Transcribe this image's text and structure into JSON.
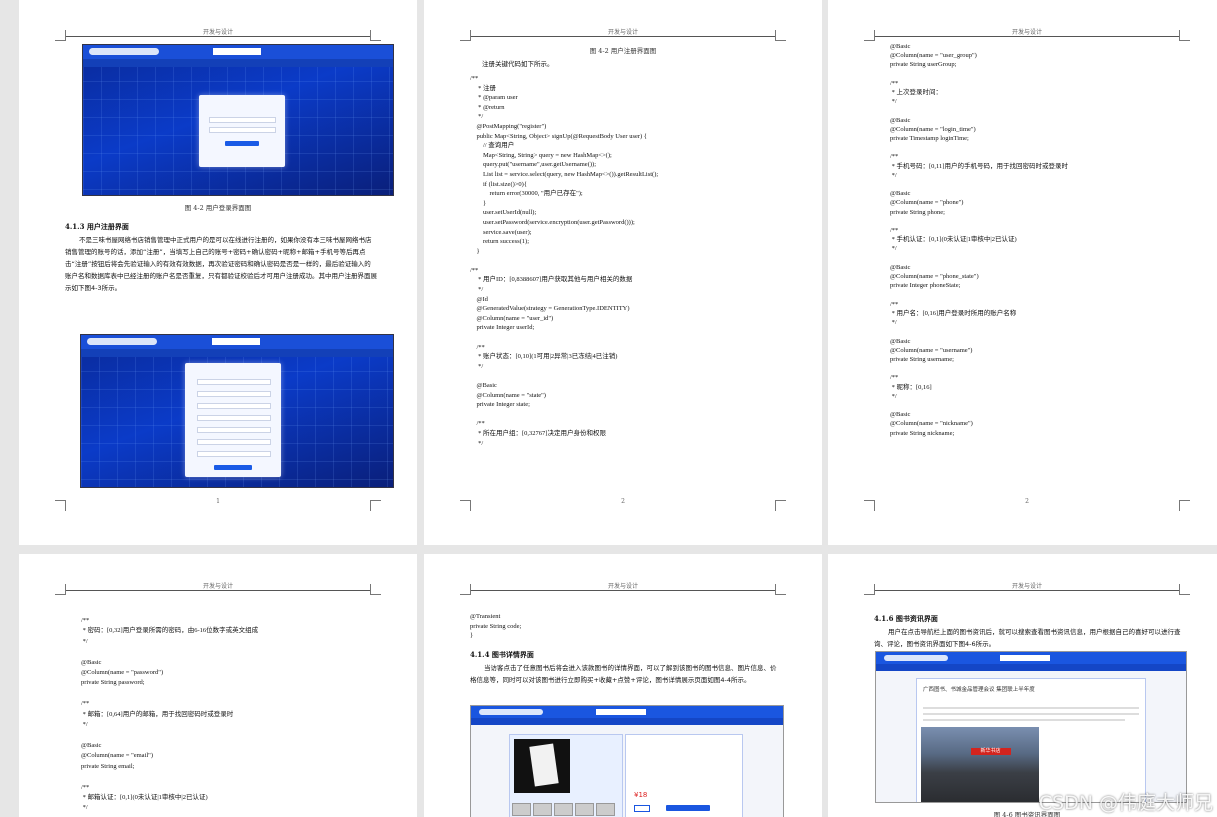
{
  "header": "开发与设计",
  "page1": {
    "caption_login": "图 4-2 用户登录界面图",
    "section_title": "4.1.3 用户注册界面",
    "paragraph": "不是三味书屋网络书店销售管理中正式用户的是可以在线进行注册的，如果你没有本三味书屋网络书店销售管理的账号的话，添加“注册”，当填写上自己的账号+密码+确认密码+昵称+邮箱+手机号等后再点击“注册”按钮后将会先验证输入的有效有效数据，再次验证密码和确认密码是否是一样的，最后验证输入的账户名和数据库表中已经注册的账户名是否重复，只有都验证校验后才可用户注册成功。其中用户注册界面展示如下图4-3所示。",
    "page_number": "1"
  },
  "page2": {
    "caption_top": "图 4-2 用户注册界面图",
    "intro": "注册关键代码如下所示。",
    "code": "/**\n     * 注册\n     * @param user\n     * @return\n     */\n    @PostMapping(\"register\")\n    public Map<String, Object> signUp(@RequestBody User user) {\n        // 查询用户\n        Map<String, String> query = new HashMap<>();\n        query.put(\"username\",user.getUsername());\n        List list = service.select(query, new HashMap<>()).getResultList();\n        if (list.size()>0){\n            return error(30000, \"用户已存在\");\n        }\n        user.setUserId(null);\n        user.setPassword(service.encryption(user.getPassword()));\n        service.save(user);\n        return success(1);\n    }\n\n/**\n     * 用户ID：[0,8388607]用户获取其他与用户相关的数据\n     */\n    @Id\n    @GeneratedValue(strategy = GenerationType.IDENTITY)\n    @Column(name = \"user_id\")\n    private Integer userId;\n\n    /**\n     * 账户状态：[0,10](1可用|2异常|3已冻结|4已注销)\n     */\n\n    @Basic\n    @Column(name = \"state\")\n    private Integer state;\n\n    /**\n     * 所在用户组：[0,32767]决定用户身份和权限\n     */",
    "page_number": "2"
  },
  "page3": {
    "code": "@Basic\n@Column(name = \"user_group\")\nprivate String userGroup;\n\n/**\n * 上次登录时间：\n */\n\n@Basic\n@Column(name = \"login_time\")\nprivate Timestamp loginTime;\n\n/**\n * 手机号码：[0,11]用户的手机号码，用于找回密码时或登录时\n */\n\n@Basic\n@Column(name = \"phone\")\nprivate String phone;\n\n/**\n * 手机认证：[0,1](0未认证|1审核中|2已认证)\n */\n\n@Basic\n@Column(name = \"phone_state\")\nprivate Integer phoneState;\n\n/**\n * 用户名：[0,16]用户登录时所用的账户名称\n */\n\n@Basic\n@Column(name = \"username\")\nprivate String username;\n\n/**\n * 昵称：[0,16]\n */\n\n@Basic\n@Column(name = \"nickname\")\nprivate String nickname;",
    "page_number": "2"
  },
  "page4": {
    "code": "/**\n * 密码：[0,32]用户登录所需的密码，由6-16位数字或英文组成\n */\n\n@Basic\n@Column(name = \"password\")\nprivate String password;\n\n/**\n * 邮箱：[0,64]用户的邮箱，用于找回密码时或登录时\n */\n\n@Basic\n@Column(name = \"email\")\nprivate String email;\n\n/**\n * 邮箱认证：[0,1](0未认证|1审核中|2已认证)\n */"
  },
  "page5": {
    "code": "@Transient\nprivate String code;\n}",
    "section_title": "4.1.4 图书详情界面",
    "paragraph": "当访客点击了任意图书后将会进入该款图书的详情界面，可以了解到该图书的图书信息、图片信息、价格信息等，同时可以对该图书进行立即购买+收藏+点赞+评论，图书详情展示页面如图4-4所示。",
    "price": "¥18"
  },
  "page6": {
    "section_title": "4.1.6 图书资讯界面",
    "paragraph": "用户在点击导航栏上面的图书资讯后，就可以搜索查看图书资讯信息，用户根据自己的喜好可以进行查询、评论，图书资讯界面如下图4-6所示。",
    "caption": "图 4-6 图书资讯界面图",
    "news_title": "广西图书、书城金品管理会议 集团联上半年度",
    "shop_sign": "新华书店",
    "watermark": "CSDN @伟庭大师兄"
  }
}
